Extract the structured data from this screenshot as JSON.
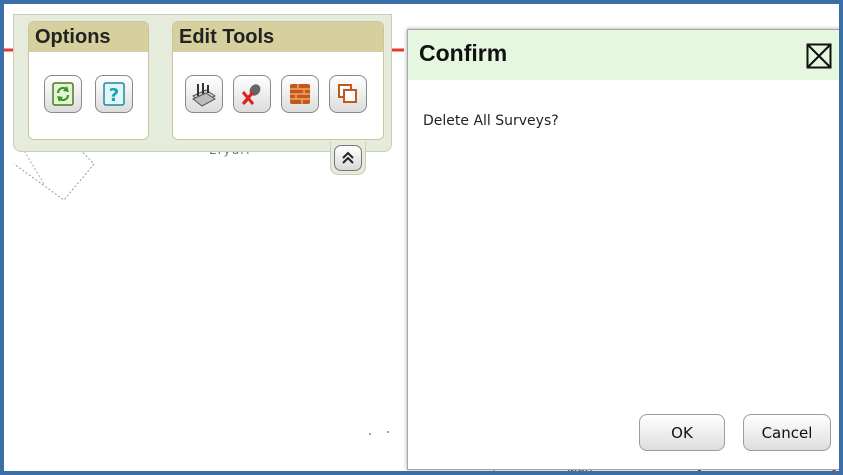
{
  "map": {
    "labels": [
      "Eryuri",
      "Matt"
    ],
    "route_color": "#e53935",
    "line_color": "#1e3fc6"
  },
  "toolbar": {
    "options_title": "Options",
    "edit_tools_title": "Edit Tools",
    "options_icons": [
      "refresh-icon",
      "help-icon"
    ],
    "edit_icons": [
      "survey-edit-icon",
      "delete-point-icon",
      "wall-layer-icon",
      "copy-shape-icon"
    ],
    "collapse_label": "≈"
  },
  "dialog": {
    "title": "Confirm",
    "message": "Delete All Surveys?",
    "ok_label": "OK",
    "cancel_label": "Cancel"
  },
  "colors": {
    "frame_border": "#3c6ea7",
    "group_header": "#d6cf9e",
    "panel_bg": "#e5ecdc",
    "dialog_header": "#e5f7df"
  }
}
